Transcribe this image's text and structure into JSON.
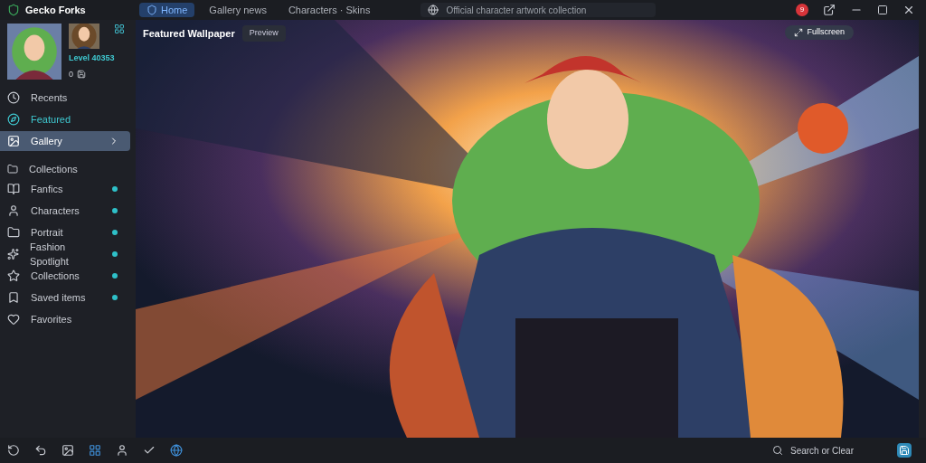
{
  "window": {
    "title": "Gecko Forks"
  },
  "tabs": [
    {
      "label": "Home",
      "selected": true
    },
    {
      "label": "Gallery news",
      "selected": false
    },
    {
      "label": "Characters · Skins",
      "selected": false
    }
  ],
  "address": "Official character artwork collection",
  "notification_count": "9",
  "profile": {
    "level": "Level 40353",
    "count": "0"
  },
  "sidebar": {
    "items": [
      {
        "label": "Recents",
        "selected": false,
        "highlighted": false
      },
      {
        "label": "Featured",
        "selected": false,
        "highlighted": true
      },
      {
        "label": "Gallery",
        "selected": true,
        "highlighted": false
      }
    ],
    "section": "Collections",
    "collection_items": [
      {
        "label": "Fanfics",
        "dot": true
      },
      {
        "label": "Characters",
        "dot": true
      },
      {
        "label": "Portrait",
        "dot": true
      },
      {
        "label": "Fashion Spotlight",
        "dot": true
      },
      {
        "label": "Collections",
        "dot": true
      },
      {
        "label": "Saved items",
        "dot": true
      },
      {
        "label": "Favorites",
        "dot": false
      }
    ]
  },
  "canvas": {
    "title": "Featured Wallpaper",
    "badge": "Preview",
    "action": "Fullscreen"
  },
  "status_bar": {
    "search_label": "Search or Clear"
  }
}
